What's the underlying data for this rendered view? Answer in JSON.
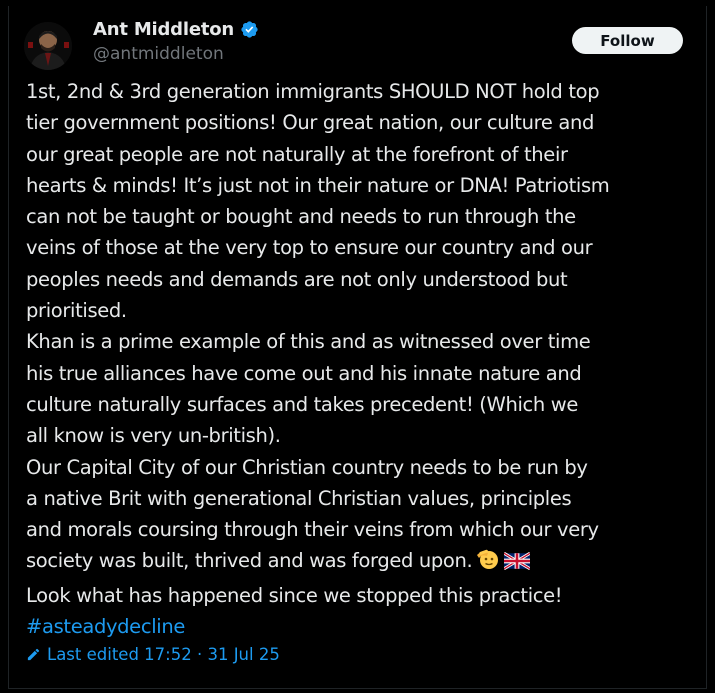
{
  "author": {
    "display_name": "Ant Middleton",
    "handle": "@antmiddleton",
    "verified_icon": "verified-badge-icon"
  },
  "follow_button": {
    "label": "Follow"
  },
  "post": {
    "lines": [
      "1st, 2nd & 3rd generation immigrants SHOULD NOT hold top",
      "tier government positions! Our great nation, our culture and",
      "our great people are not naturally at the forefront of their",
      "hearts & minds! It’s just not in their nature or DNA! Patriotism",
      "can not be taught or bought and needs to run through the",
      "veins of those at the very top to ensure our country and our",
      "peoples needs and demands are not only understood but",
      "prioritised.",
      "Khan is a prime example of this and as witnessed over time",
      "his true alliances have come out and his innate nature and",
      "culture naturally surfaces and takes precedent! (Which we",
      "all know is very un-british).",
      "Our Capital City of our Christian country needs to be run by",
      "a native Brit with generational Christian values, principles",
      "and morals coursing through their veins from which our very",
      "society was built, thrived and was forged upon.",
      "Look what has happened since we stopped this practice!"
    ],
    "emojis": [
      "saluting-face-icon",
      "uk-flag-icon"
    ],
    "hashtag": "#asteadydecline"
  },
  "edited": {
    "label": "Last edited 17:52 · 31 Jul 25"
  },
  "colors": {
    "background": "#000000",
    "text": "#e7e9ea",
    "secondary": "#71767b",
    "link": "#1d9bf0",
    "verified": "#1d9bf0"
  }
}
